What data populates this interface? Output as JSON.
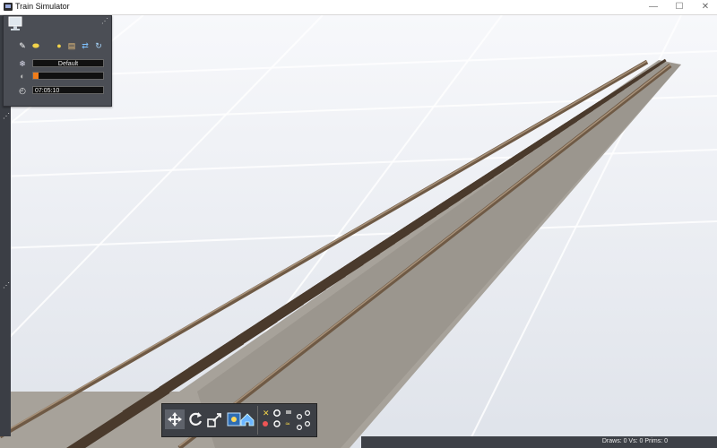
{
  "window": {
    "title": "Train Simulator",
    "minimize_label": "—",
    "maximize_label": "☐",
    "close_label": "✕"
  },
  "env_panel": {
    "weather_label": "Default",
    "time_value": "07:05:10",
    "progress": 0.08
  },
  "status": {
    "stats_text": "Draws: 0  Vs: 0  Prims: 0"
  },
  "colors": {
    "accent_orange": "#f07d1a",
    "panel_bg": "#4b4e55",
    "ground": "#e6eaf1",
    "rail": "#6f5a45",
    "sleeper": "#4a3a2c"
  }
}
